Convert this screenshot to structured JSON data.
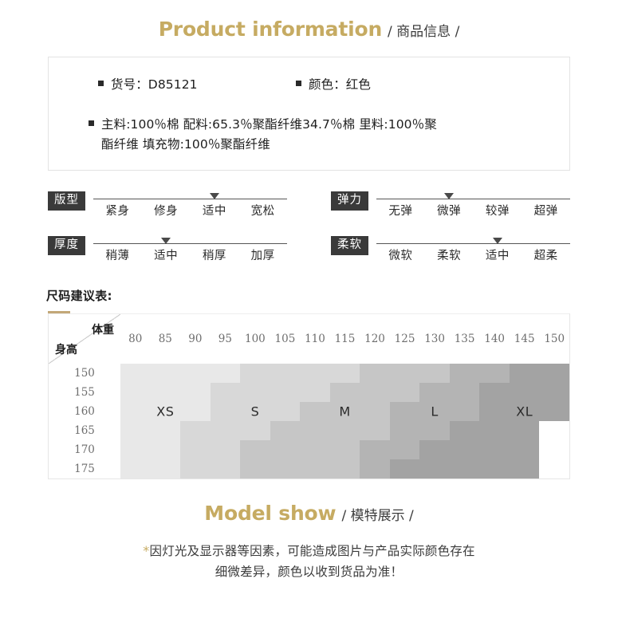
{
  "header": {
    "en_title": "Product information",
    "cn_title": "/ 商品信息 /"
  },
  "info": {
    "item_no_label": "货号：D85121",
    "color_label": "颜色：红色",
    "material_line1": "主料:100％棉 配料:65.3％聚酯纤维34.7％棉 里料:100％聚",
    "material_line2": "酯纤维 填充物:100％聚酯纤维"
  },
  "attributes": {
    "left": [
      {
        "badge": "版型",
        "options": [
          "紧身",
          "修身",
          "适中",
          "宽松"
        ],
        "selected_index": 2,
        "selected": "适中"
      },
      {
        "badge": "厚度",
        "options": [
          "稍薄",
          "适中",
          "稍厚",
          "加厚"
        ],
        "selected_index": 1,
        "selected": "适中"
      }
    ],
    "right": [
      {
        "badge": "弹力",
        "options": [
          "无弹",
          "微弹",
          "较弹",
          "超弹"
        ],
        "selected_index": 1,
        "selected": "微弹"
      },
      {
        "badge": "柔软",
        "options": [
          "微软",
          "柔软",
          "适中",
          "超柔"
        ],
        "selected_index": 2,
        "selected": "适中"
      }
    ]
  },
  "size_table": {
    "title": "尺码建议表:",
    "weight_label": "体重",
    "height_label": "身高",
    "weights": [
      "80",
      "85",
      "90",
      "95",
      "100",
      "105",
      "110",
      "115",
      "120",
      "125",
      "130",
      "135",
      "140",
      "145",
      "150"
    ],
    "heights": [
      "150",
      "155",
      "160",
      "165",
      "170",
      "175"
    ],
    "sizes": [
      "XS",
      "S",
      "M",
      "L",
      "XL"
    ],
    "colors": {
      "XS": "#e8e8e8",
      "S": "#d8d8d8",
      "M": "#c6c6c6",
      "L": "#b4b4b4",
      "XL": "#a3a3a3",
      "empty": "#ffffff"
    },
    "grid": [
      [
        "XS",
        "XS",
        "XS",
        "XS",
        "S",
        "S",
        "S",
        "S",
        "M",
        "M",
        "M",
        "L",
        "L",
        "XL",
        "XL"
      ],
      [
        "XS",
        "XS",
        "XS",
        "S",
        "S",
        "S",
        "S",
        "M",
        "M",
        "M",
        "L",
        "L",
        "XL",
        "XL",
        "XL"
      ],
      [
        "XS",
        "XS",
        "XS",
        "S",
        "S",
        "S",
        "M",
        "M",
        "M",
        "L",
        "L",
        "L",
        "XL",
        "XL",
        "XL"
      ],
      [
        "XS",
        "XS",
        "S",
        "S",
        "S",
        "M",
        "M",
        "M",
        "M",
        "L",
        "L",
        "XL",
        "XL",
        "XL",
        ""
      ],
      [
        "XS",
        "XS",
        "S",
        "S",
        "M",
        "M",
        "M",
        "M",
        "L",
        "L",
        "XL",
        "XL",
        "XL",
        "XL",
        ""
      ],
      [
        "XS",
        "XS",
        "S",
        "S",
        "M",
        "M",
        "M",
        "M",
        "L",
        "XL",
        "XL",
        "XL",
        "XL",
        "XL",
        ""
      ]
    ],
    "label_positions": [
      {
        "size": "XS",
        "row": 2,
        "col": 1
      },
      {
        "size": "S",
        "row": 2,
        "col": 4
      },
      {
        "size": "M",
        "row": 2,
        "col": 7
      },
      {
        "size": "L",
        "row": 2,
        "col": 10
      },
      {
        "size": "XL",
        "row": 2,
        "col": 13
      }
    ]
  },
  "model_show": {
    "en_title": "Model show",
    "cn_title": "/ 模特展示 /"
  },
  "footer": {
    "star": "*",
    "line1": "因灯光及显示器等因素，可能造成图片与产品实际颜色存在",
    "line2": "细微差异，颜色以收到货品为准！"
  },
  "theme": {
    "gold": "#c6ab62",
    "accent": "#c3a878",
    "badge_bg": "#3a3a3a"
  }
}
